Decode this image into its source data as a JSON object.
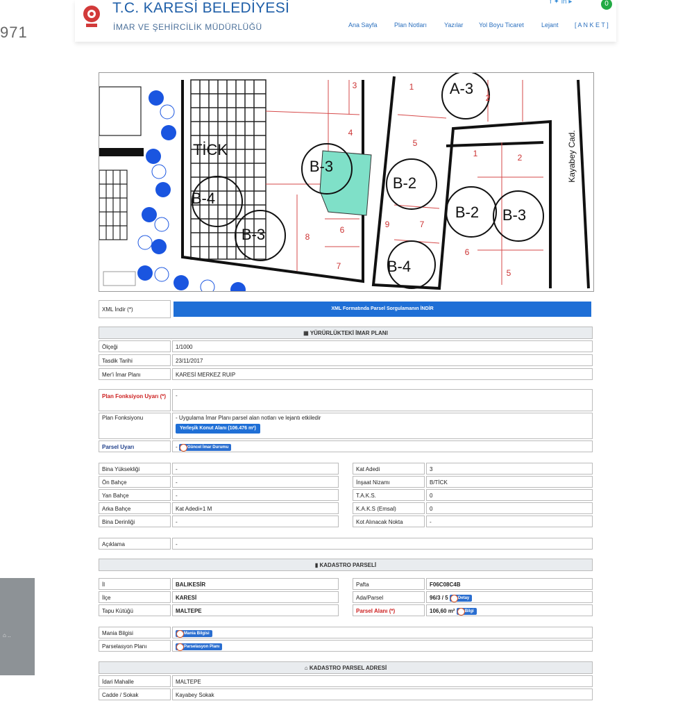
{
  "side": {
    "number": "971"
  },
  "header": {
    "title": "T.C. KARESİ BELEDİYESİ",
    "subtitle": "İMAR VE ŞEHİRCİLİK MÜDÜRLÜĞÜ",
    "nav": [
      "Ana Sayfa",
      "Plan Notları",
      "Yazılar",
      "Yol Boyu Ticaret",
      "Lejant",
      "[ A N K E T ]"
    ],
    "badge": "0"
  },
  "map": {
    "labels": [
      "3",
      "1",
      "A-3",
      "2",
      "4",
      "5",
      "TİCK",
      "B-3",
      "B-2",
      "1",
      "2",
      "B-4",
      "B-3",
      "6",
      "B-2",
      "B-3",
      "9",
      "7",
      "8",
      "B-4",
      "6",
      "7",
      "5",
      "Kayabey Cad."
    ],
    "parcel_color": "#7fe0c8"
  },
  "xml": {
    "label": "XML İndir (*)",
    "button": "XML Formatında Parsel Sorgulamanın İNDİR"
  },
  "plan_section": {
    "heading": "YÜRÜRLÜKTEKİ İMAR PLANI",
    "rows": [
      {
        "k": "Ölçeği",
        "v": "1/1000"
      },
      {
        "k": "Tasdik Tarihi",
        "v": "23/11/2017"
      },
      {
        "k": "Mer'i İmar Planı",
        "v": "KARESİ MERKEZ RUIP"
      }
    ]
  },
  "function": {
    "uyari_label": "Plan Fonksiyon Uyarı (*)",
    "uyari_value": "-",
    "fonk_label": "Plan Fonksiyonu",
    "fonk_value": "- Uygulama İmar Planı parsel alan notları ve lejantı etkiledir",
    "fonk_button": "Yerleşik Konut Alanı (106.476 m²)",
    "parsel_label": "Parsel Uyarı",
    "parsel_button": "Güncel İmar Durumu"
  },
  "build_left": [
    {
      "k": "Bina Yüksekliği",
      "v": "-"
    },
    {
      "k": "Ön Bahçe",
      "v": "-"
    },
    {
      "k": "Yan Bahçe",
      "v": "-"
    },
    {
      "k": "Arka Bahçe",
      "v": "Kat Adedi+1 M"
    },
    {
      "k": "Bina Derinliği",
      "v": "-"
    }
  ],
  "build_right": [
    {
      "k": "Kat Adedi",
      "v": "3"
    },
    {
      "k": "İnşaat Nizamı",
      "v": "B/TİCK"
    },
    {
      "k": "T.A.K.S.",
      "v": "0"
    },
    {
      "k": "K.A.K.S (Emsal)",
      "v": "0"
    },
    {
      "k": "Kot Alınacak Nokta",
      "v": "-"
    }
  ],
  "aciklama": {
    "k": "Açıklama",
    "v": "-"
  },
  "kadastro": {
    "heading": "KADASTRO PARSELİ",
    "left": [
      {
        "k": "İl",
        "v": "BALIKESİR"
      },
      {
        "k": "İlçe",
        "v": "KARESİ"
      },
      {
        "k": "Tapu Kütüğü",
        "v": "MALTEPE"
      }
    ],
    "right": [
      {
        "k": "Pafta",
        "v": "F06C08C4B"
      },
      {
        "k": "Ada/Parsel",
        "v": "96/3 / 5",
        "btn": "Detay"
      },
      {
        "k": "Parsel Alanı (*)",
        "v": "106,60 m²",
        "btn": "Bilgi"
      }
    ]
  },
  "extra": [
    {
      "k": "Mania Bilgisi",
      "btn": "Mania Bilgisi"
    },
    {
      "k": "Parselasyon Planı",
      "btn": "Parselasyon Planı"
    }
  ],
  "adres": {
    "heading": "KADASTRO PARSEL ADRESİ",
    "rows": [
      {
        "k": "İdari Mahalle",
        "v": "MALTEPE"
      },
      {
        "k": "Cadde / Sokak",
        "v": "Kayabey Sokak"
      }
    ]
  }
}
